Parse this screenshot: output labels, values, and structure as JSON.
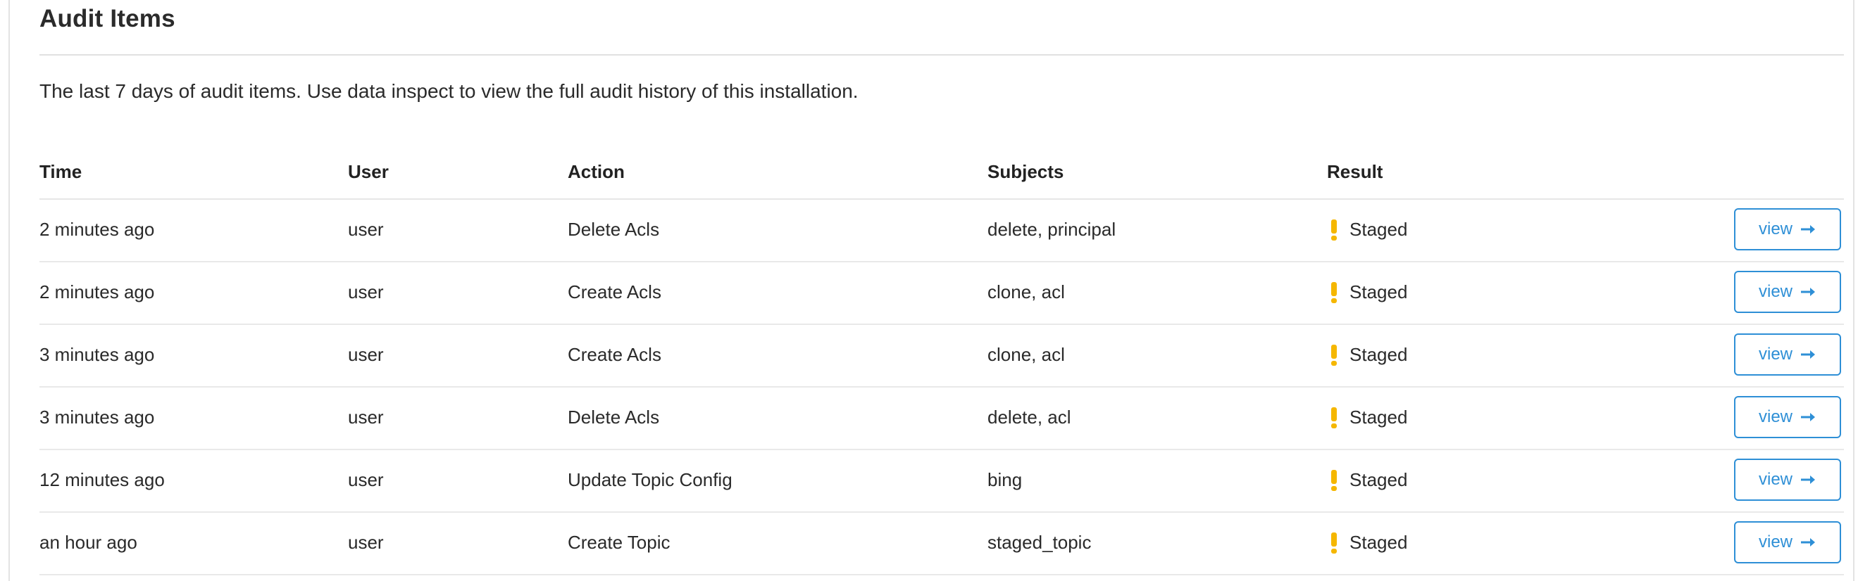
{
  "panel": {
    "title": "Audit Items",
    "description": "The last 7 days of audit items. Use data inspect to view the full audit history of this installation."
  },
  "table": {
    "headers": {
      "time": "Time",
      "user": "User",
      "action": "Action",
      "subjects": "Subjects",
      "result": "Result"
    },
    "rows": [
      {
        "time": "2 minutes ago",
        "user": "user",
        "action": "Delete Acls",
        "subjects": "delete, principal",
        "result": "Staged",
        "result_icon": "warning-icon",
        "button": "view"
      },
      {
        "time": "2 minutes ago",
        "user": "user",
        "action": "Create Acls",
        "subjects": "clone, acl",
        "result": "Staged",
        "result_icon": "warning-icon",
        "button": "view"
      },
      {
        "time": "3 minutes ago",
        "user": "user",
        "action": "Create Acls",
        "subjects": "clone, acl",
        "result": "Staged",
        "result_icon": "warning-icon",
        "button": "view"
      },
      {
        "time": "3 minutes ago",
        "user": "user",
        "action": "Delete Acls",
        "subjects": "delete, acl",
        "result": "Staged",
        "result_icon": "warning-icon",
        "button": "view"
      },
      {
        "time": "12 minutes ago",
        "user": "user",
        "action": "Update Topic Config",
        "subjects": "bing",
        "result": "Staged",
        "result_icon": "warning-icon",
        "button": "view"
      },
      {
        "time": "an hour ago",
        "user": "user",
        "action": "Create Topic",
        "subjects": "staged_topic",
        "result": "Staged",
        "result_icon": "warning-icon",
        "button": "view"
      }
    ]
  },
  "colors": {
    "accent": "#2e8fd6",
    "warning": "#f5b700",
    "border": "#e3e3e3"
  }
}
